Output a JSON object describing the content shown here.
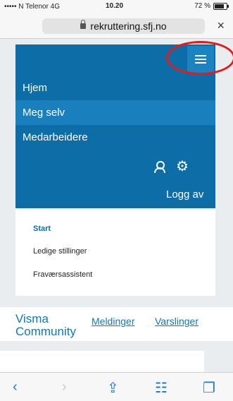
{
  "status": {
    "left": "••••• N Telenor  4G",
    "time": "10.20",
    "battery": "72 %",
    "battery_level": 0.72
  },
  "address": {
    "url": "rekruttering.sfj.no",
    "close_icon": "×"
  },
  "nav": {
    "items": [
      "Hjem",
      "Meg selv",
      "Medarbeidere"
    ],
    "logout": "Logg av"
  },
  "links": [
    "Start",
    "Ledige stillinger",
    "Fraværsassistent"
  ],
  "community": {
    "title_1": "Visma",
    "title_2": "Community",
    "meldinger": "Meldinger",
    "varslinger": "Varslinger"
  },
  "toolbar": {
    "back": "‹",
    "forward": "›",
    "share": "⇪",
    "bookmarks": "☷",
    "tabs": "❐"
  },
  "colors": {
    "header_blue": "#0d6ea7",
    "active_blue": "#1a80bd",
    "highlight_red": "#e21b1b"
  }
}
